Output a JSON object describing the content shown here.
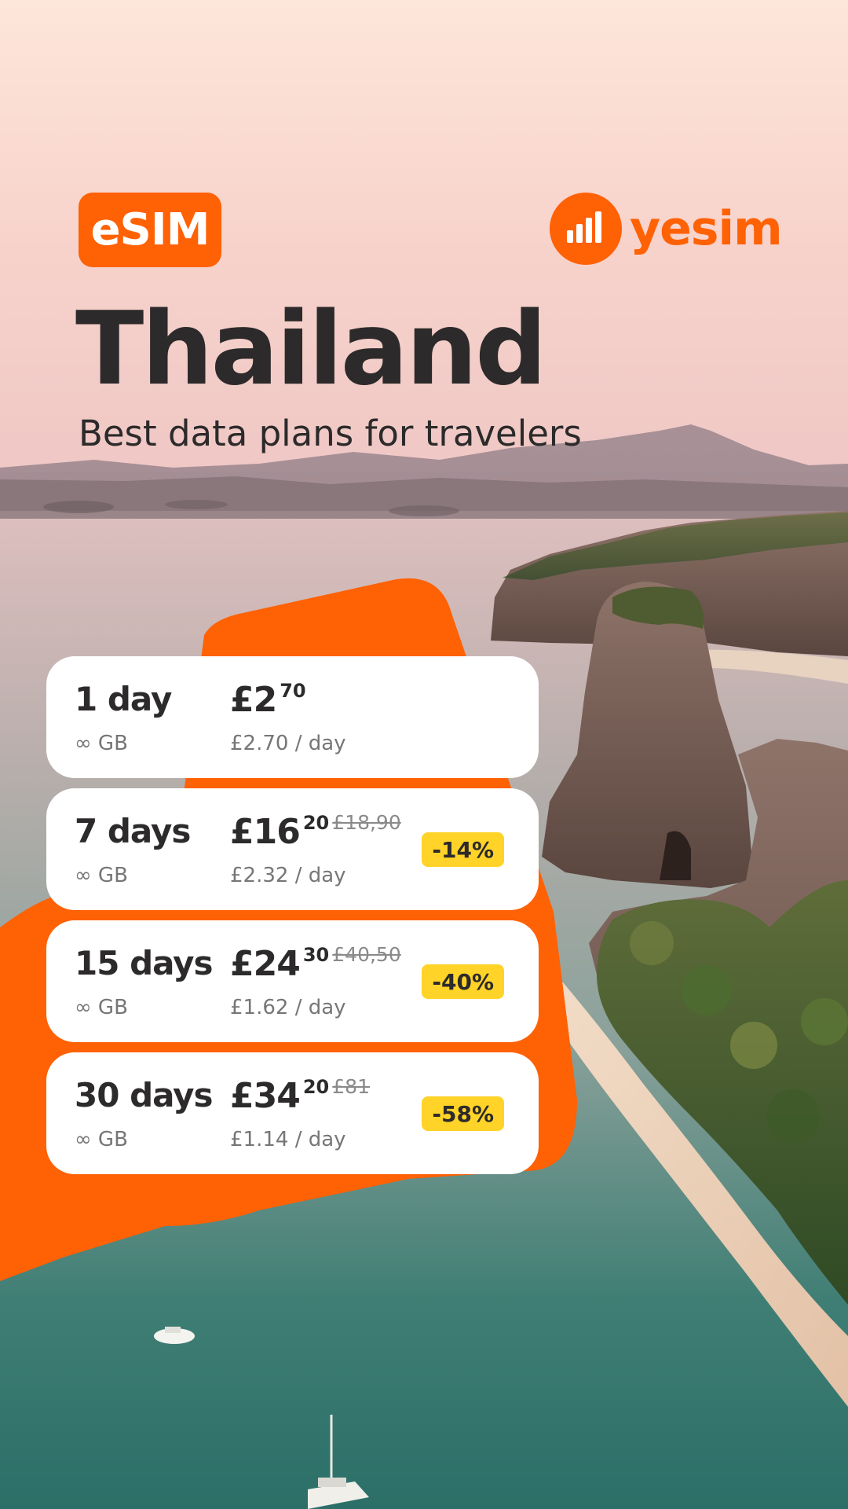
{
  "colors": {
    "brand": "#ff6105",
    "discount": "#ffd327",
    "text": "#2c2a2a"
  },
  "header": {
    "esim_badge": "eSIM",
    "brand_name": "yesim",
    "brand_icon": "signal-bars-icon"
  },
  "hero": {
    "title": "Thailand",
    "subtitle": "Best data plans for travelers"
  },
  "plans": [
    {
      "duration": "1 day",
      "data": "∞ GB",
      "price": "£2",
      "cents": "70",
      "old_price": "",
      "per_day": "£2.70 / day",
      "discount": ""
    },
    {
      "duration": "7 days",
      "data": "∞ GB",
      "price": "£16",
      "cents": "20",
      "old_price": "£18,90",
      "per_day": "£2.32 / day",
      "discount": "-14%"
    },
    {
      "duration": "15 days",
      "data": "∞ GB",
      "price": "£24",
      "cents": "30",
      "old_price": "£40,50",
      "per_day": "£1.62 / day",
      "discount": "-40%"
    },
    {
      "duration": "30 days",
      "data": "∞ GB",
      "price": "£34",
      "cents": "20",
      "old_price": "£81",
      "per_day": "£1.14 / day",
      "discount": "-58%"
    }
  ]
}
